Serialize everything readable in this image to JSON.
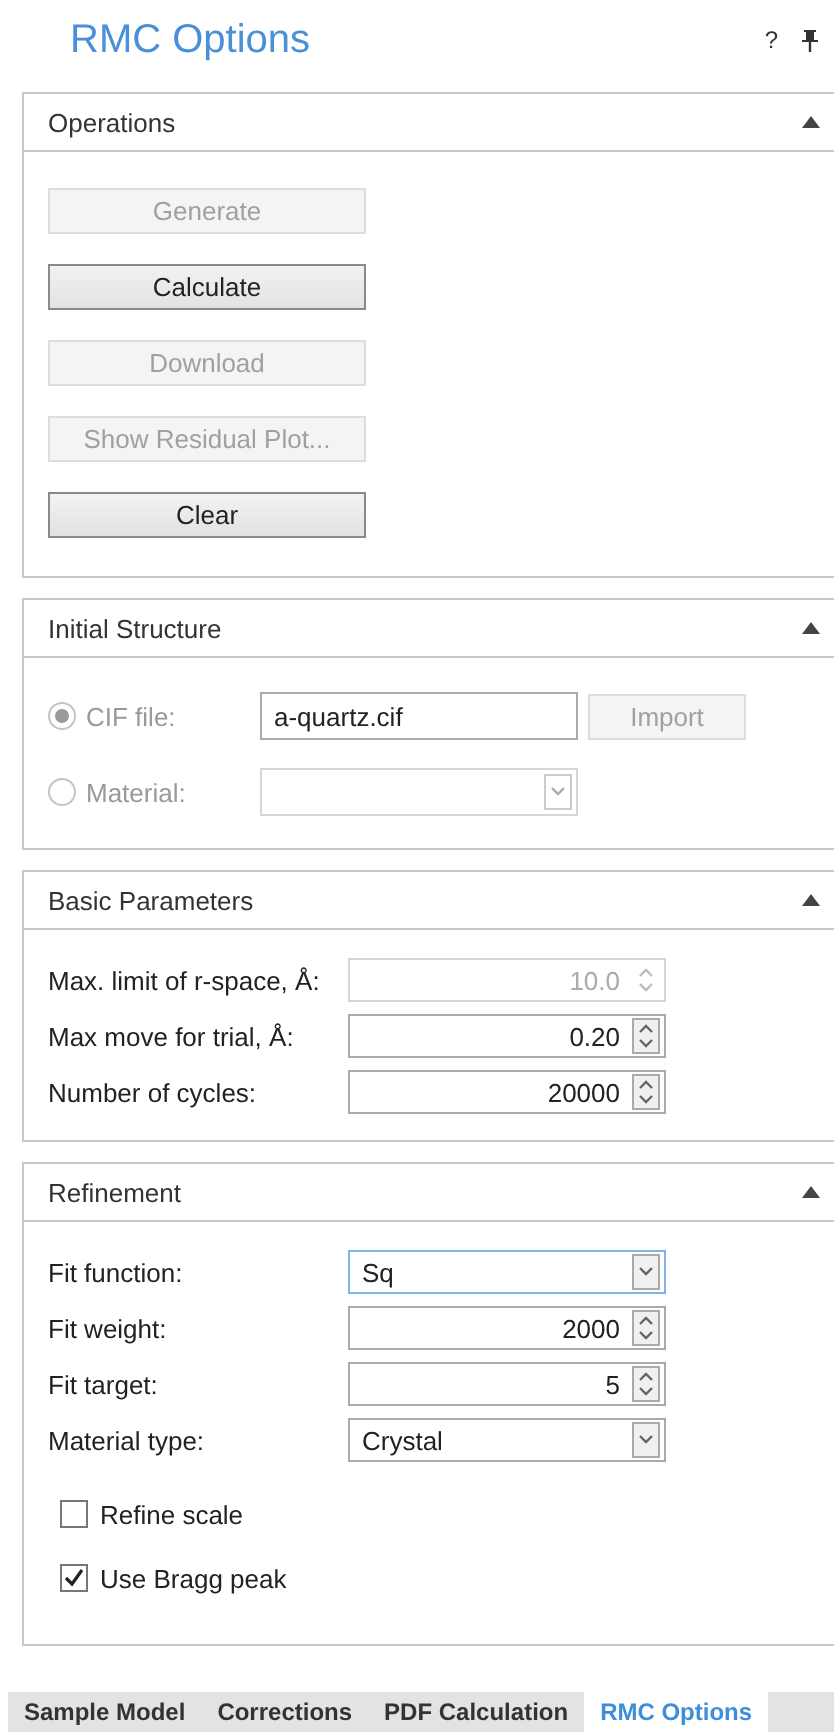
{
  "header": {
    "title": "RMC Options",
    "help": "?"
  },
  "sections": [
    {
      "kind": "buttons",
      "title": "Operations",
      "expanded": true,
      "buttons": [
        {
          "label": "Generate",
          "disabled": true
        },
        {
          "label": "Calculate",
          "disabled": false
        },
        {
          "label": "Download",
          "disabled": true
        },
        {
          "label": "Show Residual Plot...",
          "disabled": true
        },
        {
          "label": "Clear",
          "disabled": false
        }
      ]
    },
    {
      "kind": "radios",
      "title": "Initial Structure",
      "expanded": true,
      "options": [
        {
          "kind": "file",
          "label": "CIF file:",
          "selected": true,
          "disabled": true,
          "value": "a-quartz.cif",
          "button": {
            "label": "Import",
            "disabled": true
          }
        },
        {
          "kind": "select",
          "label": "Material:",
          "selected": false,
          "disabled": true
        }
      ]
    },
    {
      "kind": "form",
      "title": "Basic Parameters",
      "expanded": true,
      "rows": [
        {
          "kind": "spin",
          "label": "Max. limit of r-space, Å:",
          "value": "10.0",
          "disabled": true,
          "focused": false
        },
        {
          "kind": "spin",
          "label": "Max move for trial, Å:",
          "value": "0.20",
          "disabled": false,
          "focused": false
        },
        {
          "kind": "spin",
          "label": "Number of cycles:",
          "value": "20000",
          "disabled": false,
          "focused": false
        }
      ]
    },
    {
      "kind": "form",
      "title": "Refinement",
      "expanded": true,
      "rows": [
        {
          "kind": "select",
          "label": "Fit function:",
          "value": "Sq",
          "disabled": false,
          "focused": true
        },
        {
          "kind": "spin",
          "label": "Fit weight:",
          "value": "2000",
          "disabled": false,
          "focused": false
        },
        {
          "kind": "spin",
          "label": "Fit target:",
          "value": "5",
          "disabled": false,
          "focused": false
        },
        {
          "kind": "select",
          "label": "Material type:",
          "value": "Crystal",
          "disabled": false,
          "focused": false
        }
      ],
      "checkboxes": [
        {
          "label": "Refine scale",
          "checked": false
        },
        {
          "label": "Use Bragg peak",
          "checked": true
        }
      ]
    }
  ],
  "tabs": [
    {
      "label": "Sample Model",
      "selected": false
    },
    {
      "label": "Corrections",
      "selected": false
    },
    {
      "label": "PDF Calculation",
      "selected": false
    },
    {
      "label": "RMC Options",
      "selected": true
    }
  ]
}
